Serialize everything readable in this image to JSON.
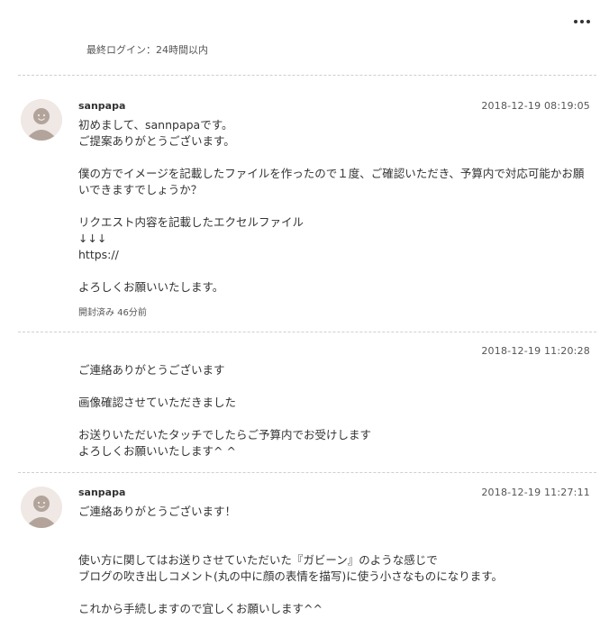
{
  "header": {
    "more_icon": "more-horizontal-icon",
    "last_login": "最終ログイン：24時間以内"
  },
  "messages": [
    {
      "sender": "sanpapa",
      "avatar_icon": "user-avatar-icon",
      "timestamp": "2018-12-19 08:19:05",
      "body": "初めまして、sannpapaです。\nご提案ありがとうございます。\n\n僕の方でイメージを記載したファイルを作ったので１度、ご確認いただき、予算内で対応可能かお願いできますでしょうか？\n\nリクエスト内容を記載したエクセルファイル\n↓↓↓\nhttps://\n\nよろしくお願いいたします。",
      "read_status": "開封済み 46分前"
    },
    {
      "timestamp": "2018-12-19 11:20:28",
      "body": "ご連絡ありがとうございます\n\n画像確認させていただきました\n\nお送りいただいたタッチでしたらご予算内でお受けします\nよろしくお願いいたします^ ^"
    },
    {
      "sender": "sanpapa",
      "avatar_icon": "user-avatar-icon",
      "timestamp": "2018-12-19 11:27:11",
      "body": "ご連絡ありがとうございます！\n\n\n使い方に関してはお送りさせていただいた『ガビーン』のような感じで\nブログの吹き出しコメント(丸の中に顔の表情を描写)に使う小さなものになります。\n\nこれから手続しますので宜しくお願いします^^"
    }
  ]
}
